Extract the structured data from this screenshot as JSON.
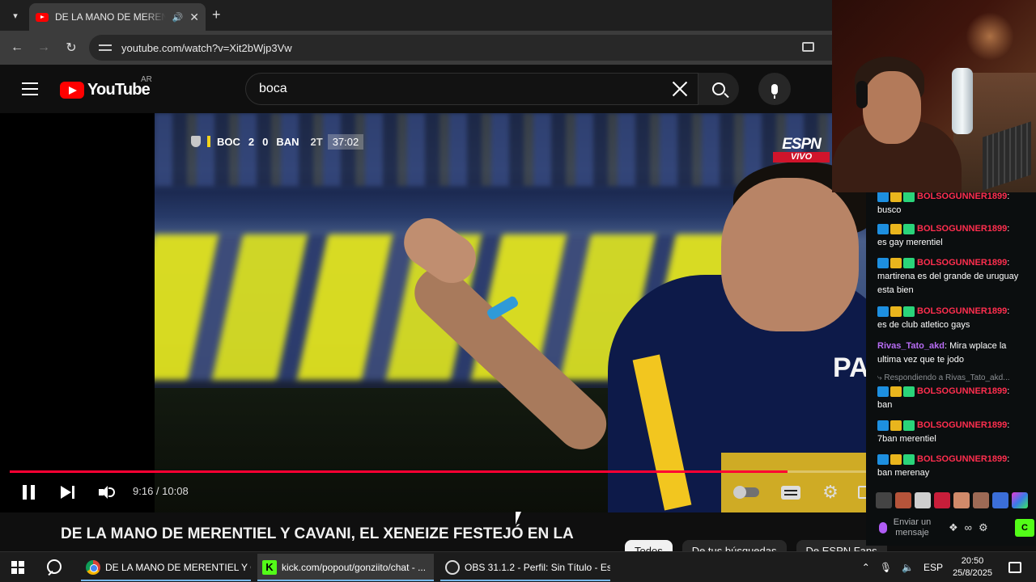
{
  "browser": {
    "tab_title": "DE LA MANO DE MERENTIEL",
    "url": "youtube.com/watch?v=Xit2bWjp3Vw"
  },
  "youtube": {
    "logo_text": "YouTube",
    "country": "AR",
    "search_value": "boca",
    "video": {
      "scoreboard": {
        "home": "BOC",
        "home_score": "2",
        "away_score": "0",
        "away": "BAN",
        "half": "2T",
        "clock": "37:02"
      },
      "network": "ESPN",
      "live_label": "VIVO",
      "jersey_text": "PA",
      "time_display": "9:16 / 10:08",
      "progress_fraction": 0.908
    },
    "title": "DE LA MANO DE MERENTIEL Y CAVANI, EL XENEIZE FESTEJÓ EN LA",
    "chips": [
      "Todos",
      "De tus búsquedas",
      "De ESPN Fans"
    ]
  },
  "chat": {
    "messages": [
      {
        "user": "BOLSOGUNNER1899",
        "text": "busco",
        "color": "red"
      },
      {
        "user": "BOLSOGUNNER1899",
        "text": "es gay merentiel",
        "color": "red"
      },
      {
        "user": "BOLSOGUNNER1899",
        "text": "martirena es del grande de uruguay esta bien",
        "color": "red"
      },
      {
        "user": "BOLSOGUNNER1899",
        "text": "es de club atletico gays",
        "color": "red"
      },
      {
        "user": "Rivas_Tato_akd",
        "text": "Mira wplace la ultima vez que te jodo",
        "color": "purple"
      },
      {
        "user": "BOLSOGUNNER1899",
        "text": "ban",
        "color": "red"
      },
      {
        "user": "BOLSOGUNNER1899",
        "text": "7ban merentiel",
        "color": "red"
      },
      {
        "user": "BOLSOGUNNER1899",
        "text": "ban merenay",
        "color": "red"
      }
    ],
    "reply_note": "Respondiendo a Rivas_Tato_akd",
    "input_placeholder": "Enviar un mensaje",
    "send_label": "C"
  },
  "taskbar": {
    "apps": [
      "DE LA MANO DE MERENTIEL Y CA...",
      "kick.com/popout/gonziito/chat - ...",
      "OBS 31.1.2 - Perfil: Sin Título - Esc..."
    ],
    "language": "ESP",
    "time": "20:50",
    "date": "25/8/2025"
  },
  "colors": {
    "youtube_red": "#ff0000",
    "progress_red": "#ff0033",
    "kick_green": "#53fc18",
    "chat_user_red": "#ff2e4e",
    "chat_user_purple": "#b86cf5"
  }
}
